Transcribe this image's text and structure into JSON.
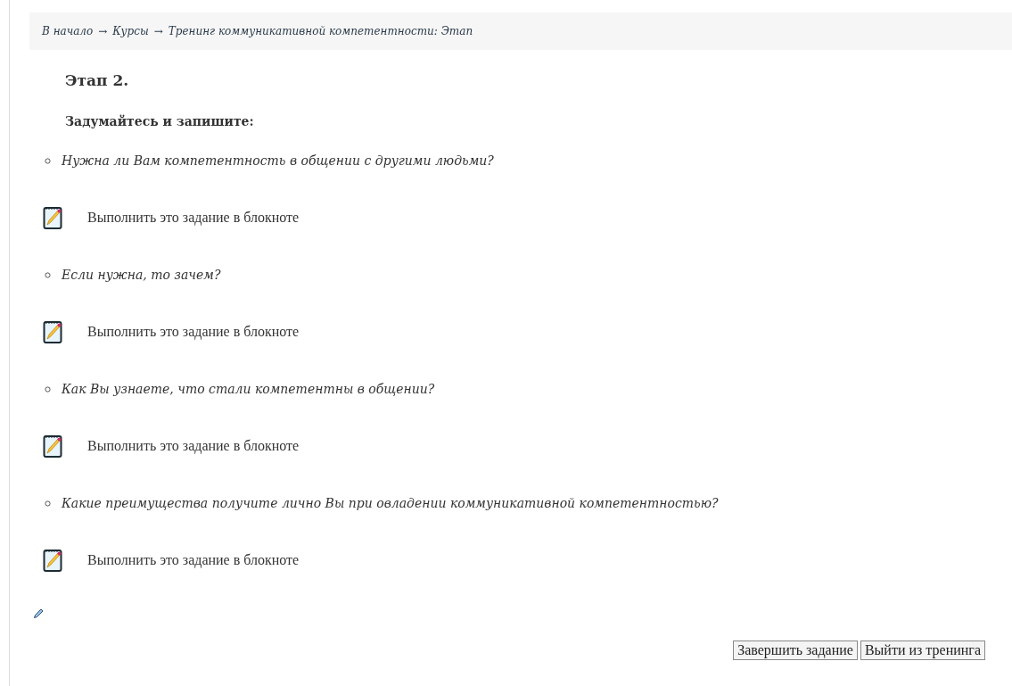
{
  "breadcrumb": [
    {
      "label": "В начало",
      "separator": "→"
    },
    {
      "label": "Курсы",
      "separator": "→"
    },
    {
      "label": "Тренинг коммуникативной компетентности: Этап"
    }
  ],
  "heading": "Этап 2.",
  "subheading": "Задумайтесь и запишите:",
  "items": [
    {
      "kind": "question",
      "text": "Нужна ли Вам компетентность в общении с другими людьми?"
    },
    {
      "kind": "notebook_link",
      "text": "Выполнить это задание в блокноте"
    },
    {
      "kind": "question",
      "text": "Если нужна, то зачем?"
    },
    {
      "kind": "notebook_link",
      "text": "Выполнить это задание в блокноте"
    },
    {
      "kind": "question",
      "text": "Как Вы узнаете, что стали компетентны в общении?"
    },
    {
      "kind": "notebook_link",
      "text": "Выполнить это задание в блокноте"
    },
    {
      "kind": "question",
      "text": "Какие преимущества получите лично Вы при овладении коммуникативной компетентностью?"
    },
    {
      "kind": "notebook_link",
      "text": "Выполнить это задание в блокноте"
    }
  ],
  "buttons": [
    "Завершить задание",
    "Выйти из тренинга"
  ]
}
